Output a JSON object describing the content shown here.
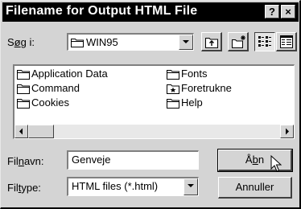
{
  "window": {
    "title": "Filename for Output HTML File",
    "help_button": "?",
    "close_button": "×"
  },
  "toolbar": {
    "look_in_label_prefix": "S",
    "look_in_label_underlined": "ø",
    "look_in_label_suffix": "g i:",
    "look_in_value": "WIN95",
    "icons": [
      "up-folder-icon",
      "new-folder-icon",
      "list-view-icon",
      "details-view-icon"
    ]
  },
  "files": [
    {
      "name": "Application Data",
      "icon": "folder-icon"
    },
    {
      "name": "Command",
      "icon": "folder-icon"
    },
    {
      "name": "Cookies",
      "icon": "folder-icon"
    },
    {
      "name": "Fonts",
      "icon": "folder-icon"
    },
    {
      "name": "Foretrukne",
      "icon": "favorites-folder-icon"
    },
    {
      "name": "Help",
      "icon": "folder-icon"
    }
  ],
  "filename": {
    "label_prefix": "Fil",
    "label_underlined": "n",
    "label_suffix": "avn:",
    "value": "Genveje"
  },
  "filetype": {
    "label_prefix": "Fil",
    "label_underlined": "t",
    "label_suffix": "ype:",
    "value": "HTML files (*.html)"
  },
  "buttons": {
    "open_prefix": "Å",
    "open_underlined": "b",
    "open_suffix": "n",
    "cancel": "Annuller"
  },
  "colors": {
    "titlebar": "#000000",
    "face": "#d4d4d4",
    "field": "#ffffff"
  }
}
